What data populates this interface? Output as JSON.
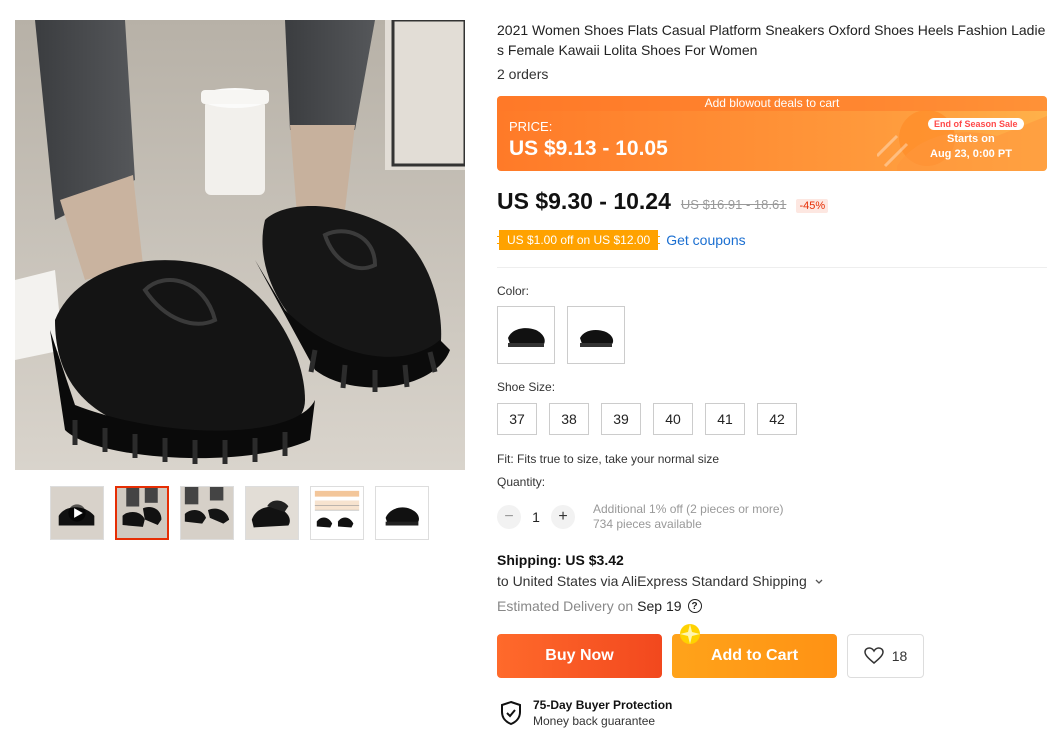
{
  "product": {
    "title": "2021 Women Shoes Flats Casual Platform Sneakers Oxford Shoes Heels Fashion Ladies Female Kawaii Lolita Shoes For Women",
    "orders": "2 orders"
  },
  "deal": {
    "banner_text": "Add blowout deals to cart",
    "price_label": "PRICE:",
    "price": "US $9.13 - 10.05",
    "season_tag": "End of Season Sale",
    "starts_on": "Starts on",
    "start_date": "Aug 23, 0:00 PT"
  },
  "pricing": {
    "current": "US $9.30 - 10.24",
    "original": "US $16.91 - 18.61",
    "discount": "-45%"
  },
  "coupon": {
    "text": "US $1.00 off on US $12.00",
    "link": "Get coupons"
  },
  "options": {
    "color_label": "Color:",
    "size_label": "Shoe Size:",
    "sizes": [
      "37",
      "38",
      "39",
      "40",
      "41",
      "42"
    ],
    "fit": "Fit: Fits true to size, take your normal size"
  },
  "quantity": {
    "label": "Quantity:",
    "value": "1",
    "minus": "−",
    "plus": "+",
    "additional": "Additional 1% off (2 pieces or more)",
    "available": "734 pieces available"
  },
  "shipping": {
    "cost": "Shipping: US $3.42",
    "route": "to United States via AliExpress Standard Shipping",
    "delivery_label": "Estimated Delivery on",
    "delivery_date": "Sep 19",
    "help": "?"
  },
  "actions": {
    "buy_now": "Buy Now",
    "add_to_cart": "Add to Cart",
    "wishlist_count": "18"
  },
  "protection": {
    "title": "75-Day Buyer Protection",
    "subtitle": "Money back guarantee"
  },
  "colors": {
    "accent": "#e62e04",
    "deal_orange": "#ff8a33",
    "coupon": "#ffa200",
    "link": "#1b6fd1"
  }
}
